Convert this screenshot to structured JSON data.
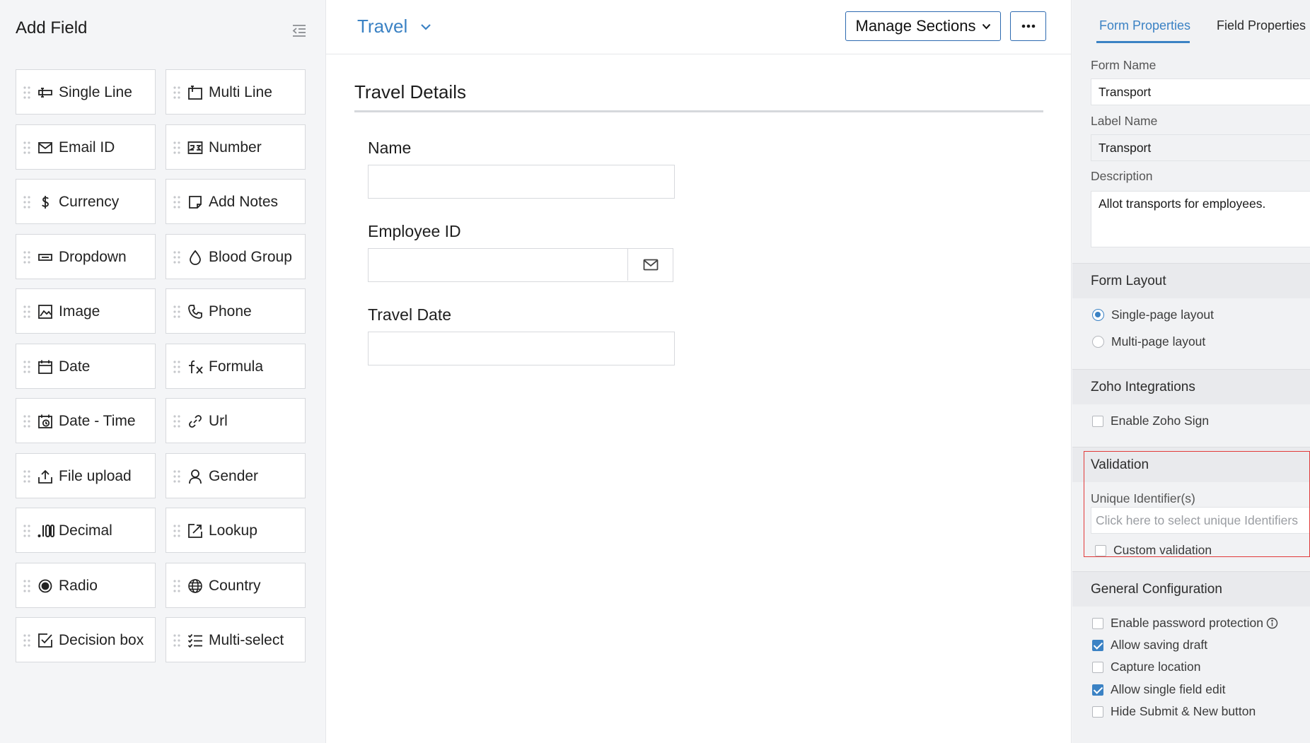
{
  "left": {
    "title": "Add Field",
    "fields": [
      {
        "label": "Single Line",
        "icon": "single-line-icon"
      },
      {
        "label": "Multi Line",
        "icon": "multi-line-icon"
      },
      {
        "label": "Email ID",
        "icon": "email-icon"
      },
      {
        "label": "Number",
        "icon": "number-icon"
      },
      {
        "label": "Currency",
        "icon": "currency-icon"
      },
      {
        "label": "Add Notes",
        "icon": "notes-icon"
      },
      {
        "label": "Dropdown",
        "icon": "dropdown-icon"
      },
      {
        "label": "Blood Group",
        "icon": "blood-drop-icon"
      },
      {
        "label": "Image",
        "icon": "image-icon"
      },
      {
        "label": "Phone",
        "icon": "phone-icon"
      },
      {
        "label": "Date",
        "icon": "calendar-icon"
      },
      {
        "label": "Formula",
        "icon": "formula-icon"
      },
      {
        "label": "Date - Time",
        "icon": "date-time-icon"
      },
      {
        "label": "Url",
        "icon": "link-icon"
      },
      {
        "label": "File upload",
        "icon": "upload-icon"
      },
      {
        "label": "Gender",
        "icon": "person-icon"
      },
      {
        "label": "Decimal",
        "icon": "decimal-icon"
      },
      {
        "label": "Lookup",
        "icon": "lookup-icon"
      },
      {
        "label": "Radio",
        "icon": "radio-icon"
      },
      {
        "label": "Country",
        "icon": "globe-icon"
      },
      {
        "label": "Decision box",
        "icon": "checkbox-icon"
      },
      {
        "label": "Multi-select",
        "icon": "list-check-icon"
      }
    ]
  },
  "center": {
    "form_title": "Travel",
    "manage_sections_label": "Manage Sections",
    "section_title": "Travel Details",
    "fields": {
      "name": "Name",
      "employee_id": "Employee ID",
      "travel_date": "Travel Date"
    }
  },
  "right": {
    "tabs": {
      "form": "Form Properties",
      "field": "Field Properties"
    },
    "form_name_label": "Form Name",
    "form_name_value": "Transport",
    "label_name_label": "Label Name",
    "label_name_value": "Transport",
    "description_label": "Description",
    "description_value": "Allot transports for employees.",
    "layout": {
      "title": "Form Layout",
      "single": "Single-page layout",
      "multi": "Multi-page layout"
    },
    "integrations": {
      "title": "Zoho Integrations",
      "sign": "Enable Zoho Sign"
    },
    "validation": {
      "title": "Validation",
      "uid_label": "Unique Identifier(s)",
      "uid_placeholder": "Click here to select unique Identifiers",
      "custom": "Custom validation"
    },
    "general": {
      "title": "General Configuration",
      "password": "Enable password protection",
      "draft": "Allow saving draft",
      "location": "Capture location",
      "single_edit": "Allow single field edit",
      "hide_submit": "Hide Submit & New button"
    }
  },
  "colors": {
    "accent": "#3b82c4",
    "highlight": "#e23a3a"
  }
}
